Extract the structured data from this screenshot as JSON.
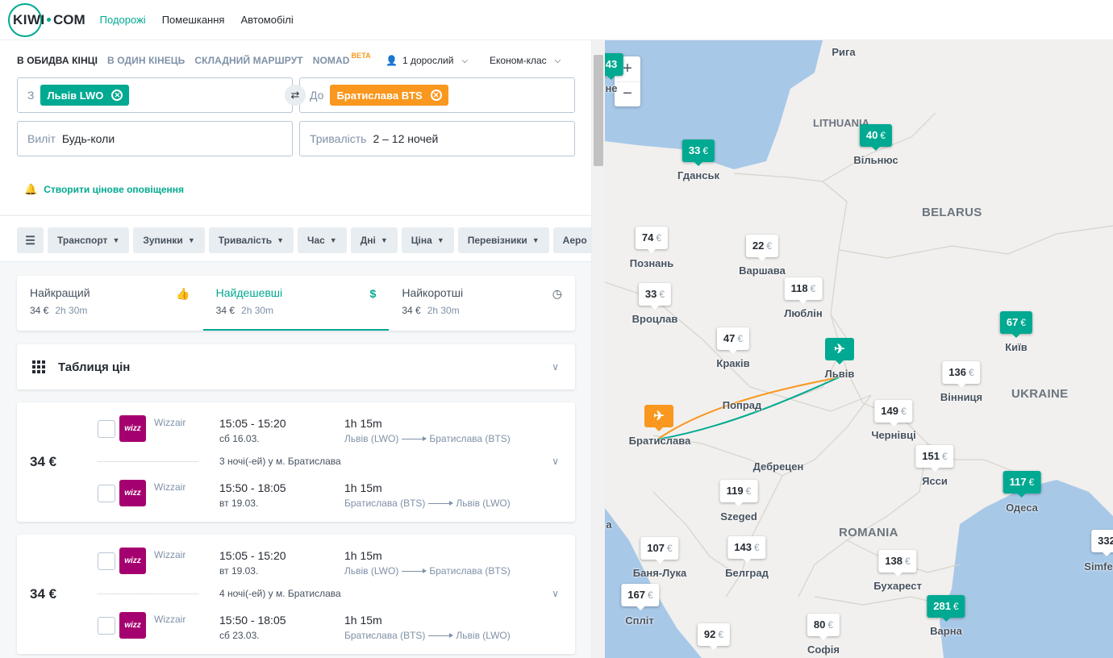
{
  "header": {
    "logo_kiwi": "KIWI",
    "logo_com": "COM",
    "nav": [
      "Подорожі",
      "Помешкання",
      "Автомобілі"
    ]
  },
  "search": {
    "modes": [
      "В ОБИДВА КІНЦІ",
      "В ОДИН КІНЕЦЬ",
      "СКЛАДНИЙ МАРШРУТ",
      "NOMAD"
    ],
    "beta": "BETA",
    "passengers": "1 дорослий",
    "cabin": "Економ-клас",
    "from_label": "З",
    "from_value": "Львів LWO",
    "to_label": "До",
    "to_value": "Братислава BTS",
    "depart_label": "Виліт",
    "depart_value": "Будь-коли",
    "duration_label": "Тривалість",
    "duration_value": "2 – 12 ночей",
    "alert": "Створити цінове оповіщення"
  },
  "filters": [
    "Транспорт",
    "Зупинки",
    "Тривалість",
    "Час",
    "Дні",
    "Ціна",
    "Перевізники",
    "Аеро"
  ],
  "sorting": [
    {
      "title": "Найкращий",
      "price": "34 €",
      "time": "2h 30m",
      "icon": "thumbs-up-icon"
    },
    {
      "title": "Найдешевші",
      "price": "34 €",
      "time": "2h 30m",
      "icon": "dollar-icon"
    },
    {
      "title": "Найкоротші",
      "price": "34 €",
      "time": "2h 30m",
      "icon": "clock-icon"
    }
  ],
  "price_table": "Таблиця цін",
  "results": [
    {
      "price": "34 €",
      "outbound": {
        "carrier": "Wizzair",
        "time": "15:05 - 15:20",
        "date": "сб 16.03.",
        "duration": "1h 15m",
        "from": "Львів (LWO)",
        "to": "Братислава (BTS)"
      },
      "stay": "3 ночі(-ей) у м. Братислава",
      "inbound": {
        "carrier": "Wizzair",
        "time": "15:50 - 18:05",
        "date": "вт 19.03.",
        "duration": "1h 15m",
        "from": "Братислава (BTS)",
        "to": "Львів (LWO)"
      }
    },
    {
      "price": "34 €",
      "outbound": {
        "carrier": "Wizzair",
        "time": "15:05 - 15:20",
        "date": "вт 19.03.",
        "duration": "1h 15m",
        "from": "Львів (LWO)",
        "to": "Братислава (BTS)"
      },
      "stay": "4 ночі(-ей) у м. Братислава",
      "inbound": {
        "carrier": "Wizzair",
        "time": "15:50 - 18:05",
        "date": "сб 23.03.",
        "duration": "1h 15m",
        "from": "Братислава (BTS)",
        "to": "Львів (LWO)"
      }
    }
  ],
  "map": {
    "zoom_in": "+",
    "zoom_out": "−",
    "countries": [
      "LITHUANIA",
      "BELARUS",
      "UKRAINE",
      "ROMANIA"
    ],
    "labels": {
      "riga": "Рига",
      "gdansk": "Гданськ",
      "vilnius": "Вільнюс",
      "poznan": "Познань",
      "warsaw": "Варшава",
      "wroclaw": "Вроцлав",
      "lublin": "Люблін",
      "krakow": "Краків",
      "lviv": "Львів",
      "kyiv": "Київ",
      "poprad": "Попрад",
      "bratislava": "Братислава",
      "vinnytsia": "Вінниця",
      "chernivtsi": "Чернівці",
      "debrecen": "Дебрецен",
      "iasi": "Ясси",
      "szeged": "Szeged",
      "odesa": "Одеса",
      "banjaluka": "Баня-Лука",
      "belgrade": "Белград",
      "bucharest": "Бухарест",
      "split": "Спліт",
      "sofia": "Софія",
      "varna": "Варна",
      "simferopol": "Simfe",
      "ne": "не",
      "a": "а"
    },
    "prices": {
      "gdansk": "33",
      "vilnius": "40",
      "poznan": "74",
      "warsaw": "22",
      "wroclaw": "33",
      "lublin": "118",
      "krakow": "47",
      "kyiv": "67",
      "vinnytsia": "136",
      "chernivtsi": "149",
      "iasi": "151",
      "odesa": "117",
      "szeged": "119",
      "banjaluka": "107",
      "belgrade": "143",
      "bucharest": "138",
      "split": "167",
      "varna": "281",
      "sofia": "80",
      "bottom": "92",
      "edge_left": "43",
      "edge_right": "332"
    },
    "currency": "€"
  }
}
